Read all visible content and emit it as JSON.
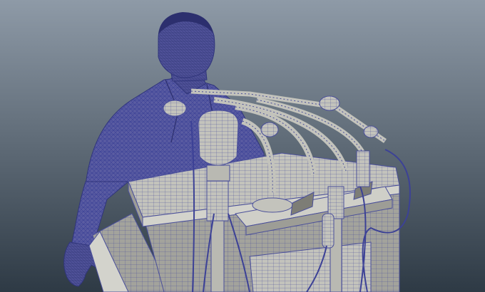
{
  "viewport": {
    "background_top": "#8e9aa7",
    "background_bottom": "#2e3a45",
    "wire_color": "#3c4196",
    "mesh_fill": "#5a5ca2",
    "shaded_fill": "#b9b9b2",
    "shaded_dark": "#8f8f89",
    "shaded_light": "#d3d3cc"
  },
  "scene": {
    "subject": "figure-at-podium-wireframe",
    "objects": [
      "speaker-figure",
      "podium",
      "microphone-cluster",
      "microphone-cables"
    ]
  }
}
